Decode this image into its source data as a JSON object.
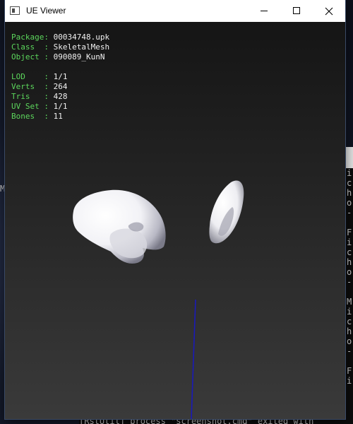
{
  "window": {
    "title": "UE Viewer"
  },
  "info": {
    "package": {
      "label": "Package:",
      "value": "00034748.upk"
    },
    "class": {
      "label": "Class  :",
      "value": "SkeletalMesh"
    },
    "object": {
      "label": "Object :",
      "value": "090089_KunN"
    },
    "lod": {
      "label": "LOD    :",
      "value": "1/1"
    },
    "verts": {
      "label": "Verts  :",
      "value": "264"
    },
    "tris": {
      "label": "Tris   :",
      "value": "428"
    },
    "uvset": {
      "label": "UV Set :",
      "value": "1/1"
    },
    "bones": {
      "label": "Bones  :",
      "value": "11"
    }
  },
  "console": {
    "left_char": "M",
    "right_lines": [
      "i",
      "c",
      "h",
      "o",
      "-",
      "",
      "F",
      "i",
      "c",
      "h",
      "o",
      "-",
      "",
      "M",
      "i",
      "c",
      "h",
      "o",
      "-",
      "",
      "F",
      "i"
    ],
    "bottom_text": "[RstUtil] process \"screenshot.cmd\" exited with"
  },
  "colors": {
    "label_green": "#5cd65c",
    "bone_line": "#1a1ab8"
  }
}
